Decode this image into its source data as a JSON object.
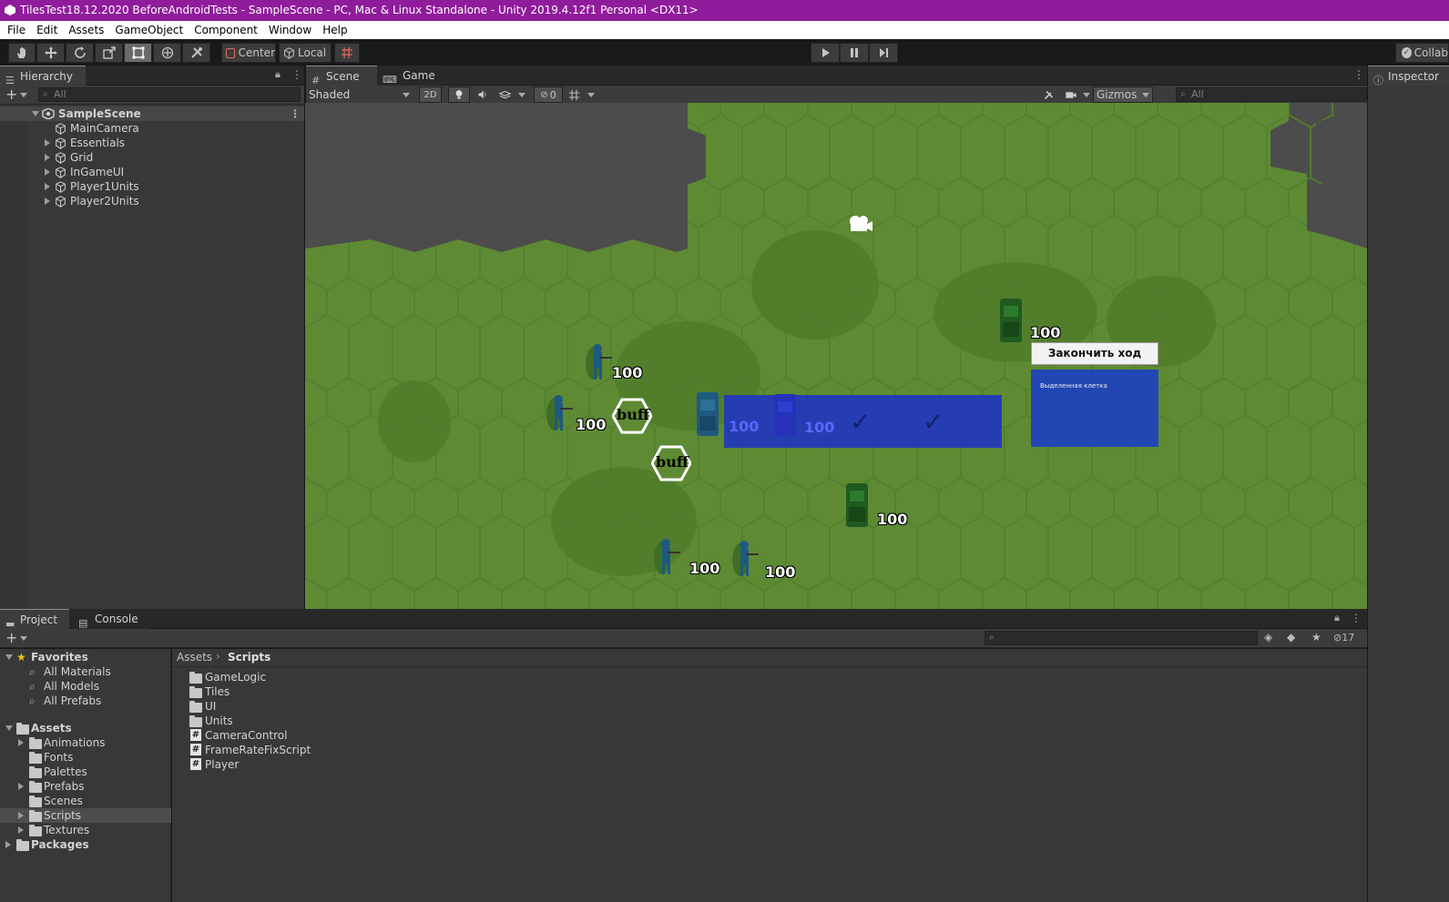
{
  "window": {
    "title": "TilesTest18.12.2020 BeforeAndroidTests - SampleScene - PC, Mac & Linux Standalone - Unity 2019.4.12f1 Personal <DX11>"
  },
  "menu": [
    "File",
    "Edit",
    "Assets",
    "GameObject",
    "Component",
    "Window",
    "Help"
  ],
  "toolbar": {
    "center_label": "Center",
    "local_label": "Local",
    "collab_label": "Collab"
  },
  "hierarchy": {
    "tab_label": "Hierarchy",
    "search_placeholder": "All",
    "scene_name": "SampleScene",
    "items": [
      "MainCamera",
      "Essentials",
      "Grid",
      "InGameUI",
      "Player1Units",
      "Player2Units"
    ]
  },
  "scene_view": {
    "tabs": [
      "Scene",
      "Game"
    ],
    "shading_mode": "Shaded",
    "mode_2d": "2D",
    "hidden_count": "0",
    "gizmos_label": "Gizmos",
    "search_placeholder": "All",
    "end_turn_label": "Закончить ход",
    "panel_text": "Выделенная клетка",
    "buff_label": "buff",
    "unit_hp": "100"
  },
  "inspector": {
    "tab_label": "Inspector"
  },
  "project": {
    "tabs": [
      "Project",
      "Console"
    ],
    "hidden_count": "17",
    "favorites_label": "Favorites",
    "favorites": [
      "All Materials",
      "All Models",
      "All Prefabs"
    ],
    "assets_label": "Assets",
    "asset_folders": [
      "Animations",
      "Fonts",
      "Palettes",
      "Prefabs",
      "Scenes",
      "Scripts",
      "Textures"
    ],
    "packages_label": "Packages",
    "breadcrumb": [
      "Assets",
      "Scripts"
    ],
    "folders": [
      "GameLogic",
      "Tiles",
      "UI",
      "Units"
    ],
    "scripts": [
      "CameraControl",
      "FrameRateFixScript",
      "Player"
    ]
  },
  "colors": {
    "title_bar": "#8f1c9b",
    "grass": "#5d8a33",
    "selection_blue": "#1c2fc9"
  }
}
